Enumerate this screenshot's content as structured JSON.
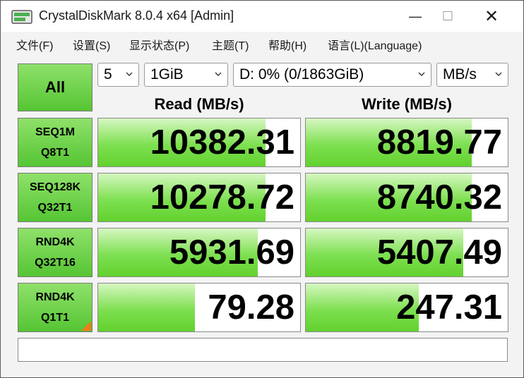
{
  "window": {
    "title": "CrystalDiskMark 8.0.4 x64 [Admin]",
    "controls": {
      "minimize": "—",
      "maximize": "☐",
      "close": "✕"
    }
  },
  "menu": [
    {
      "label": "文件(F)"
    },
    {
      "label": "设置(S)"
    },
    {
      "label": "显示状态(P)"
    },
    {
      "label": "主题(T)"
    },
    {
      "label": "帮助(H)"
    },
    {
      "label": "语言(L)(Language)"
    }
  ],
  "controls": {
    "all_button": "All",
    "count": "5",
    "size": "1GiB",
    "drive": "D: 0% (0/1863GiB)",
    "unit": "MB/s"
  },
  "headers": {
    "read": "Read (MB/s)",
    "write": "Write (MB/s)"
  },
  "tests": [
    {
      "line1": "SEQ1M",
      "line2": "Q8T1",
      "read": "10382.31",
      "write": "8819.77",
      "read_fill": 0.83,
      "write_fill": 0.82
    },
    {
      "line1": "SEQ128K",
      "line2": "Q32T1",
      "read": "10278.72",
      "write": "8740.32",
      "read_fill": 0.83,
      "write_fill": 0.82
    },
    {
      "line1": "RND4K",
      "line2": "Q32T16",
      "read": "5931.69",
      "write": "5407.49",
      "read_fill": 0.79,
      "write_fill": 0.78
    },
    {
      "line1": "RND4K",
      "line2": "Q1T1",
      "read": "79.28",
      "write": "247.31",
      "read_fill": 0.48,
      "write_fill": 0.56
    }
  ],
  "comment": "",
  "colors": {
    "accent_green": "#62d12e",
    "corner_orange": "#f07a1a"
  }
}
